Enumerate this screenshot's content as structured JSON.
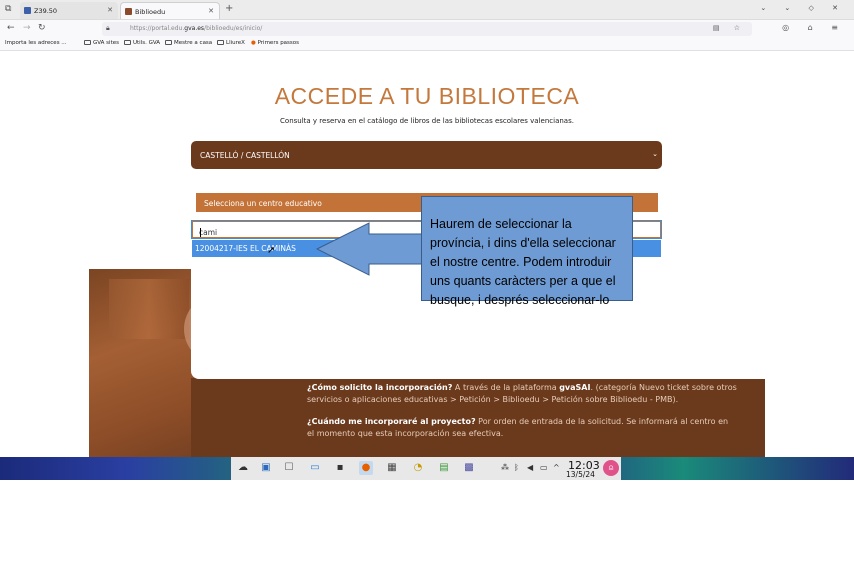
{
  "browser": {
    "tabs": [
      {
        "label": "Z39.50",
        "favicon_color": "#3b5fa8"
      },
      {
        "label": "Biblioedu",
        "favicon_color": "#8b4a2b"
      }
    ],
    "new_tab": "+",
    "url_prefix": "https://portal.edu.",
    "url_domain": "gva.es",
    "url_path": "/biblioedu/es/inicio/",
    "bookmarks": [
      "Importa les adreces ...",
      "GVA sites",
      "Utils. GVA",
      "Mestre a casa",
      "LliureX",
      "Primers passos"
    ]
  },
  "page": {
    "title": "ACCEDE A TU BIBLIOTECA",
    "subtitle": "Consulta y reserva en el catálogo de libros de las bibliotecas escolares valencianas.",
    "province_selected": "CASTELLÓ / CASTELLÓN",
    "center_header": "Selecciona un centro educativo",
    "center_input_value": "cami",
    "suggestion": "12004217-IES EL CAMINÀS",
    "info": {
      "q1": "¿Cómo solicito la incorporación?",
      "a1_pre": " A través de la plataforma ",
      "a1_bold": "gvaSAI",
      "a1_post": ". (categoría Nuevo ticket sobre otros servicios o aplicaciones educativas > Petición > Biblioedu > Petición sobre Biblioedu - PMB).",
      "q2": "¿Cuándo me incorporaré al proyecto?",
      "a2": " Por orden de entrada de la solicitud. Se informará al centro en el momento que esta incorporación sea efectiva."
    }
  },
  "annotation": {
    "text": "Haurem de seleccionar la província, i dins d'ella seleccionar el nostre centre. Podem introduir uns quants caràcters per a que el busque, i després seleccionar-lo"
  },
  "taskbar": {
    "time": "12:03",
    "date": "13/5/24"
  },
  "colors": {
    "brand_brown": "#6b3a1d",
    "accent_orange": "#c47338",
    "title_orange": "#c4783c",
    "selection_blue": "#4a90e2",
    "note_blue": "#6f9bd4"
  }
}
